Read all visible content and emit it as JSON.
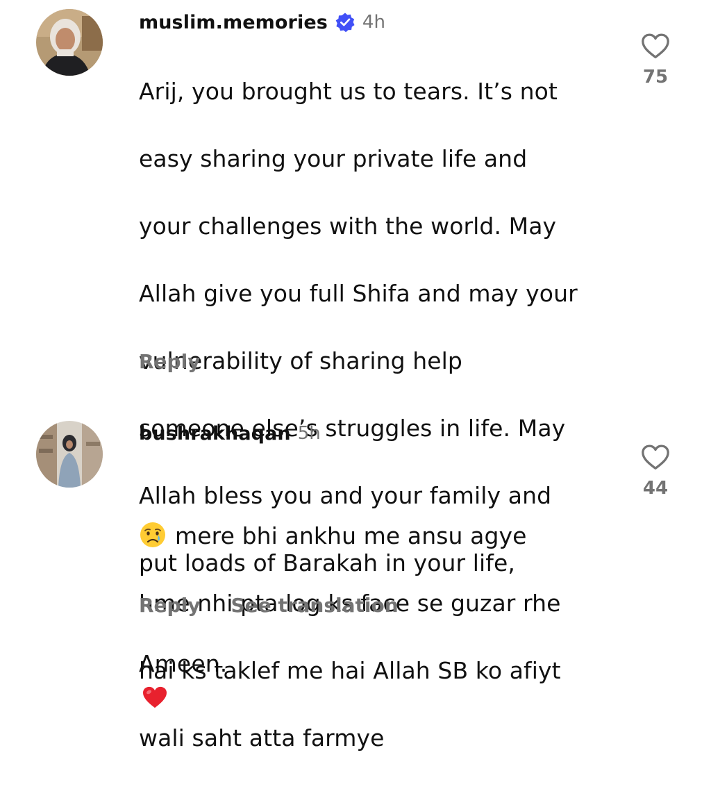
{
  "comments": [
    {
      "username": "muslim.memories",
      "verified": true,
      "time": "4h",
      "lines": [
        "Arij, you brought us to tears. It’s not",
        "easy sharing your private life and",
        "your challenges with the world. May",
        "Allah give you full Shifa and may your",
        "vulnerability of sharing help",
        "someone else’s struggles in life. May",
        "Allah bless you and your family and",
        "put loads of Barakah in your life,",
        "Ameen."
      ],
      "reply_label": "Reply",
      "like_count": "75",
      "emoji": "red-heart"
    },
    {
      "username": "bushrakhaqan",
      "verified": false,
      "time": "5h",
      "lines": [
        "mere bhi ankhu me ansu agye",
        "hme nhi  pta log ks face se guzar rhe",
        "hai ks taklef me hai Allah SB ko afiyt",
        "wali saht atta farmye"
      ],
      "reply_label": "Reply",
      "translation_label": "See translation",
      "like_count": "44",
      "emoji": "crying-face"
    }
  ],
  "colors": {
    "verified_blue": "#4150F7",
    "secondary_text": "#737373",
    "heart_red": "#E8212E"
  },
  "icons": [
    "verified-badge-icon",
    "heart-outline-icon",
    "red-heart-emoji",
    "crying-face-emoji"
  ]
}
